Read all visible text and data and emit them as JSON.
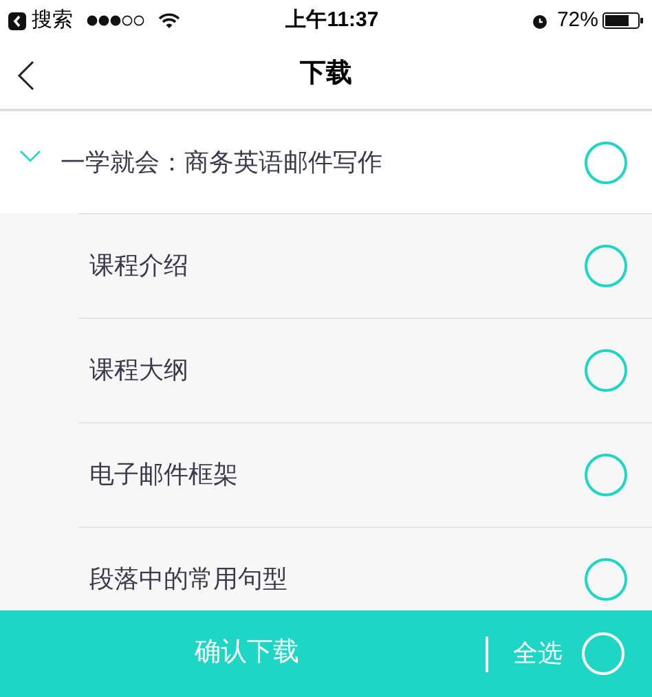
{
  "status_bar": {
    "back_app": "搜索",
    "time": "上午11:37",
    "battery": "72%"
  },
  "nav": {
    "title": "下载"
  },
  "course": {
    "title": "一学就会：商务英语邮件写作",
    "expanded": true,
    "checked": false,
    "lessons": [
      {
        "title": "课程介绍",
        "checked": false
      },
      {
        "title": "课程大纲",
        "checked": false
      },
      {
        "title": "电子邮件框架",
        "checked": false
      },
      {
        "title": "段落中的常用句型",
        "checked": false
      }
    ]
  },
  "footer": {
    "confirm": "确认下载",
    "select_all": "全选",
    "select_all_checked": false
  }
}
